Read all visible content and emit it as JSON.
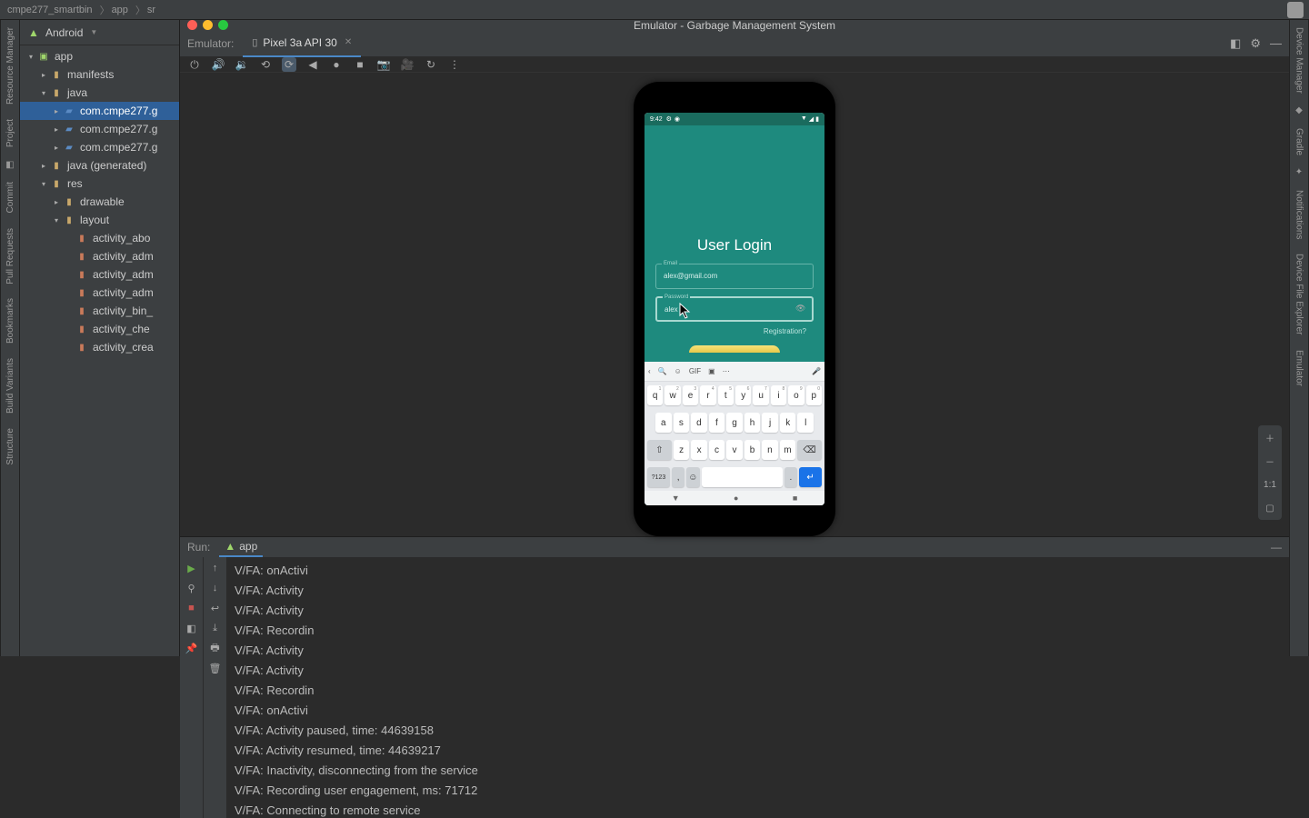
{
  "breadcrumb": [
    "cmpe277_smartbin",
    "app",
    "sr"
  ],
  "project_header": "Android",
  "tree": [
    {
      "d": 0,
      "caret": "▾",
      "ic": "ic-module",
      "label": "app",
      "sel": false
    },
    {
      "d": 1,
      "caret": "▸",
      "ic": "ic-folder",
      "label": "manifests",
      "sel": false
    },
    {
      "d": 1,
      "caret": "▾",
      "ic": "ic-folder",
      "label": "java",
      "sel": false
    },
    {
      "d": 2,
      "caret": "▸",
      "ic": "ic-pkg",
      "label": "com.cmpe277.g",
      "sel": true
    },
    {
      "d": 2,
      "caret": "▸",
      "ic": "ic-pkg",
      "label": "com.cmpe277.g",
      "sel": false
    },
    {
      "d": 2,
      "caret": "▸",
      "ic": "ic-pkg",
      "label": "com.cmpe277.g",
      "sel": false
    },
    {
      "d": 1,
      "caret": "▸",
      "ic": "ic-folder",
      "label": "java (generated)",
      "sel": false
    },
    {
      "d": 1,
      "caret": "▾",
      "ic": "ic-folder",
      "label": "res",
      "sel": false
    },
    {
      "d": 2,
      "caret": "▸",
      "ic": "ic-folder",
      "label": "drawable",
      "sel": false
    },
    {
      "d": 2,
      "caret": "▾",
      "ic": "ic-folder",
      "label": "layout",
      "sel": false
    },
    {
      "d": 3,
      "caret": "",
      "ic": "ic-file",
      "label": "activity_abo",
      "sel": false
    },
    {
      "d": 3,
      "caret": "",
      "ic": "ic-file",
      "label": "activity_adm",
      "sel": false
    },
    {
      "d": 3,
      "caret": "",
      "ic": "ic-file",
      "label": "activity_adm",
      "sel": false
    },
    {
      "d": 3,
      "caret": "",
      "ic": "ic-file",
      "label": "activity_adm",
      "sel": false
    },
    {
      "d": 3,
      "caret": "",
      "ic": "ic-file",
      "label": "activity_bin_",
      "sel": false
    },
    {
      "d": 3,
      "caret": "",
      "ic": "ic-file",
      "label": "activity_che",
      "sel": false
    },
    {
      "d": 3,
      "caret": "",
      "ic": "ic-file",
      "label": "activity_crea",
      "sel": false
    }
  ],
  "window_title": "Emulator - Garbage Management System",
  "emulator_label": "Emulator:",
  "device_tab": "Pixel 3a API 30",
  "phone": {
    "status_time": "9:42",
    "login_title": "User Login",
    "email_label": "Email",
    "email_value": "alex@gmail.com",
    "password_label": "Password",
    "password_value": "alex",
    "registration": "Registration?"
  },
  "keyboard": {
    "suggest_gif": "GIF",
    "row1": [
      [
        "q",
        "1"
      ],
      [
        "w",
        "2"
      ],
      [
        "e",
        "3"
      ],
      [
        "r",
        "4"
      ],
      [
        "t",
        "5"
      ],
      [
        "y",
        "6"
      ],
      [
        "u",
        "7"
      ],
      [
        "i",
        "8"
      ],
      [
        "o",
        "9"
      ],
      [
        "p",
        "0"
      ]
    ],
    "row2": [
      "a",
      "s",
      "d",
      "f",
      "g",
      "h",
      "j",
      "k",
      "l"
    ],
    "row3": [
      "z",
      "x",
      "c",
      "v",
      "b",
      "n",
      "m"
    ],
    "sym": "?123"
  },
  "zoom_11": "1:1",
  "run": {
    "label": "Run:",
    "tab": "app",
    "lines": [
      "V/FA: onActivi",
      "V/FA: Activity",
      "V/FA: Activity",
      "V/FA: Recordin",
      "V/FA: Activity",
      "V/FA: Activity",
      "V/FA: Recordin",
      "V/FA: onActivi",
      "V/FA: Activity paused, time: 44639158",
      "V/FA: Activity resumed, time: 44639217",
      "V/FA: Inactivity, disconnecting from the service",
      "V/FA: Recording user engagement, ms: 71712",
      "V/FA: Connecting to remote service"
    ]
  },
  "left_rail": [
    {
      "type": "label",
      "text": "Resource Manager"
    },
    {
      "type": "label",
      "text": "Project"
    },
    {
      "type": "icon",
      "text": "◧"
    },
    {
      "type": "label",
      "text": "Commit"
    },
    {
      "type": "label",
      "text": "Pull Requests"
    },
    {
      "type": "label",
      "text": "Bookmarks"
    },
    {
      "type": "label",
      "text": "Build Variants"
    },
    {
      "type": "label",
      "text": "Structure"
    }
  ],
  "right_rail": [
    {
      "type": "label",
      "text": "Device Manager"
    },
    {
      "type": "icon",
      "text": "◆"
    },
    {
      "type": "label",
      "text": "Gradle"
    },
    {
      "type": "icon",
      "text": "✦"
    },
    {
      "type": "label",
      "text": "Notifications"
    },
    {
      "type": "label",
      "text": "Device File Explorer"
    },
    {
      "type": "label",
      "text": "Emulator"
    }
  ]
}
